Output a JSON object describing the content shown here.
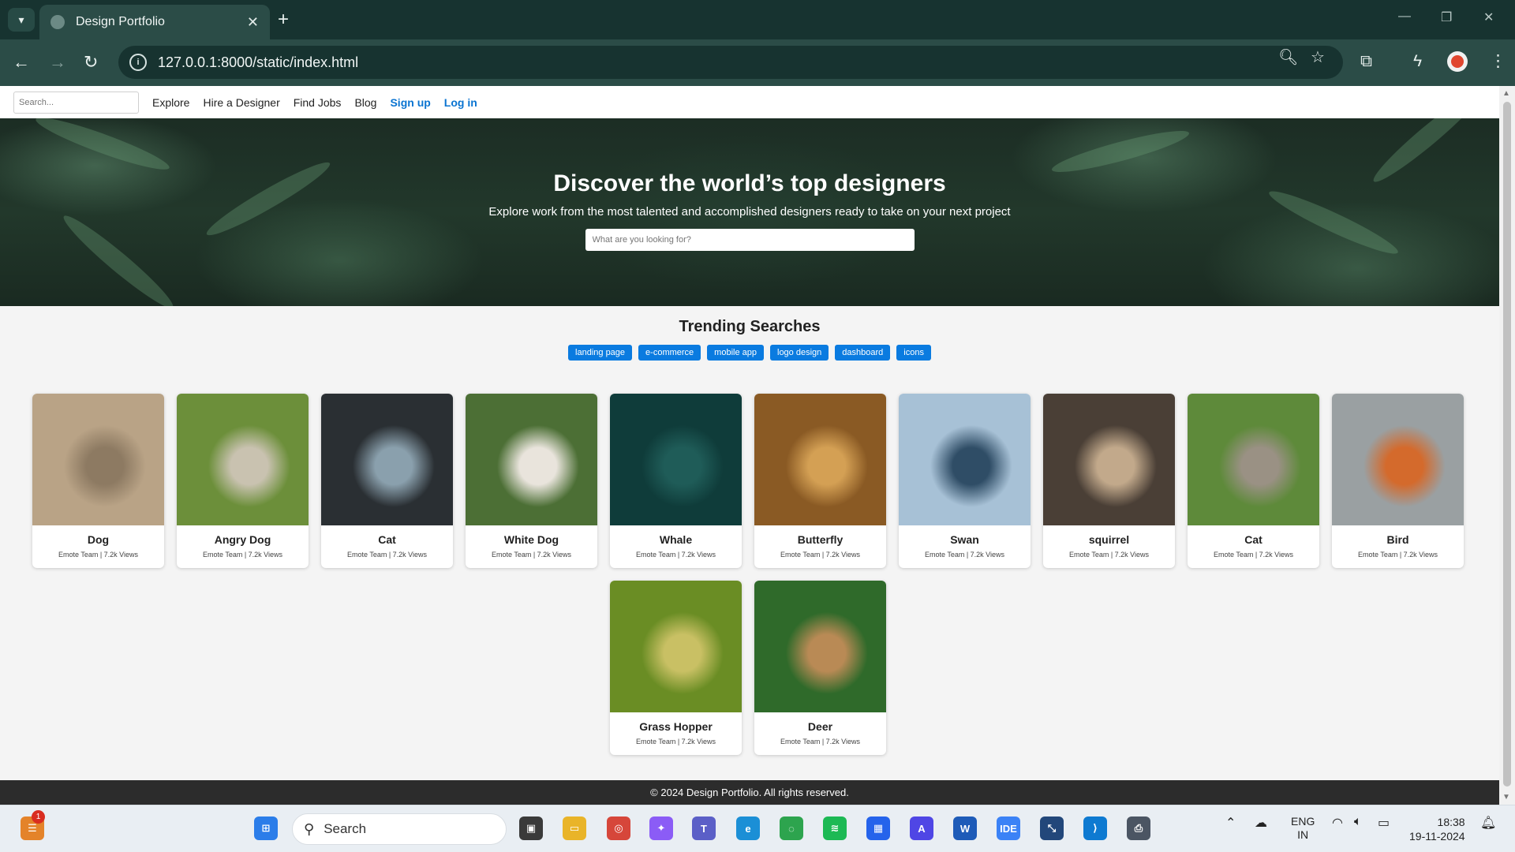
{
  "browser": {
    "tab_title": "Design Portfolio",
    "url": "127.0.0.1:8000/static/index.html"
  },
  "site_nav": {
    "search_placeholder": "Search...",
    "links": [
      "Explore",
      "Hire a Designer",
      "Find Jobs",
      "Blog"
    ],
    "signup": "Sign up",
    "login": "Log in"
  },
  "hero": {
    "title": "Discover the world’s top designers",
    "subtitle": "Explore work from the most talented and accomplished designers ready to take on your next project",
    "search_placeholder": "What are you looking for?"
  },
  "trending": {
    "heading": "Trending Searches",
    "tags": [
      "landing page",
      "e-commerce",
      "mobile app",
      "logo design",
      "dashboard",
      "icons"
    ]
  },
  "cards": [
    {
      "title": "Dog",
      "meta": "Emote Team | 7.2k Views",
      "colors": [
        "#b9a386",
        "#8d7a62"
      ]
    },
    {
      "title": "Angry Dog",
      "meta": "Emote Team | 7.2k Views",
      "colors": [
        "#6c8f3a",
        "#c9c2b0"
      ]
    },
    {
      "title": "Cat",
      "meta": "Emote Team | 7.2k Views",
      "colors": [
        "#2a2f33",
        "#8aa0ad"
      ]
    },
    {
      "title": "White Dog",
      "meta": "Emote Team | 7.2k Views",
      "colors": [
        "#4c6f35",
        "#e9e4dc"
      ]
    },
    {
      "title": "Whale",
      "meta": "Emote Team | 7.2k Views",
      "colors": [
        "#0f3c3a",
        "#1f5c58"
      ]
    },
    {
      "title": "Butterfly",
      "meta": "Emote Team | 7.2k Views",
      "colors": [
        "#8a5a24",
        "#d4a054"
      ]
    },
    {
      "title": "Swan",
      "meta": "Emote Team | 7.2k Views",
      "colors": [
        "#a7c1d6",
        "#2f4d66"
      ]
    },
    {
      "title": "squirrel",
      "meta": "Emote Team | 7.2k Views",
      "colors": [
        "#4a3f36",
        "#c2a98b"
      ]
    },
    {
      "title": "Cat",
      "meta": "Emote Team | 7.2k Views",
      "colors": [
        "#5e8a3a",
        "#9a9184"
      ]
    },
    {
      "title": "Bird",
      "meta": "Emote Team | 7.2k Views",
      "colors": [
        "#9aa0a2",
        "#d46a2c"
      ]
    },
    {
      "title": "Grass Hopper",
      "meta": "Emote Team | 7.2k Views",
      "colors": [
        "#6a8d24",
        "#c9c064"
      ]
    },
    {
      "title": "Deer",
      "meta": "Emote Team | 7.2k Views",
      "colors": [
        "#2f6a2a",
        "#b98a55"
      ]
    }
  ],
  "footer": {
    "text": "© 2024 Design Portfolio. All rights reserved."
  },
  "taskbar": {
    "search_label": "Search",
    "notification_count": "1",
    "language": "ENG",
    "region": "IN",
    "time": "18:38",
    "date": "19-11-2024"
  }
}
